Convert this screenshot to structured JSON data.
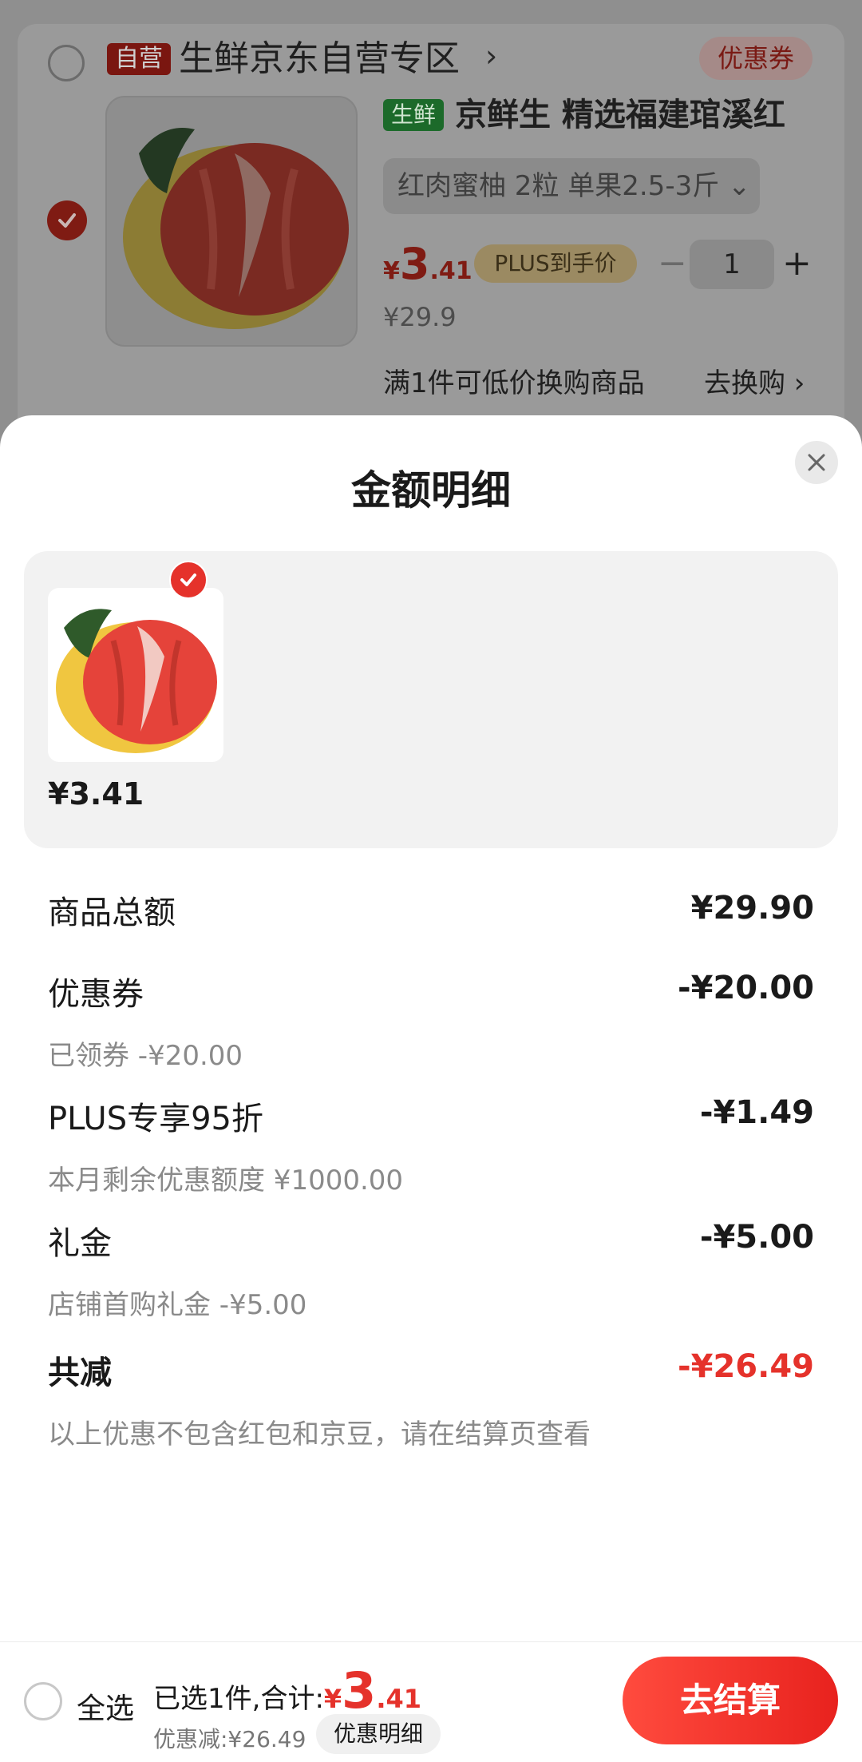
{
  "cart": {
    "store_badge": "自营",
    "store_title": "生鲜京东自营专区",
    "store_chevron": "›",
    "coupon_label": "优惠券",
    "fresh_tag": "生鲜",
    "product_title": "京鲜生 精选福建琯溪红",
    "spec": "红肉蜜柚 2粒 单果2.5-3斤 ⌄",
    "price_currency": "¥",
    "price_int": "3",
    "price_dec": ".41",
    "plus_label": "PLUS到手价",
    "qty_minus": "−",
    "quantity": "1",
    "qty_plus": "+",
    "original_price": "¥29.9",
    "tradein_text": "满1件可低价换购商品",
    "tradein_link": "去换购 ›"
  },
  "sheet": {
    "title": "金额明细",
    "item_price": "¥3.41",
    "rows": [
      {
        "label": "商品总额",
        "value": "¥29.90"
      },
      {
        "label": "优惠券",
        "value": "-¥20.00",
        "sub": "已领券 -¥20.00"
      },
      {
        "label": "PLUS专享95折",
        "value": "-¥1.49",
        "sub": "本月剩余优惠额度 ¥1000.00"
      },
      {
        "label": "礼金",
        "value": "-¥5.00",
        "sub": "店铺首购礼金 -¥5.00"
      },
      {
        "label": "共减",
        "value": "-¥26.49",
        "sub": "以上优惠不包含红包和京豆，请在结算页查看"
      }
    ]
  },
  "bottom_bar": {
    "select_all": "全选",
    "selected_prefix": "已选1件,合计:",
    "total_currency": "¥",
    "total_int": "3",
    "total_dec": ".41",
    "discount": "优惠减:¥26.49",
    "detail_button": "优惠明细",
    "checkout": "去结算"
  },
  "colors": {
    "accent_red": "#e5322b",
    "fresh_green": "#1c6a2a"
  }
}
